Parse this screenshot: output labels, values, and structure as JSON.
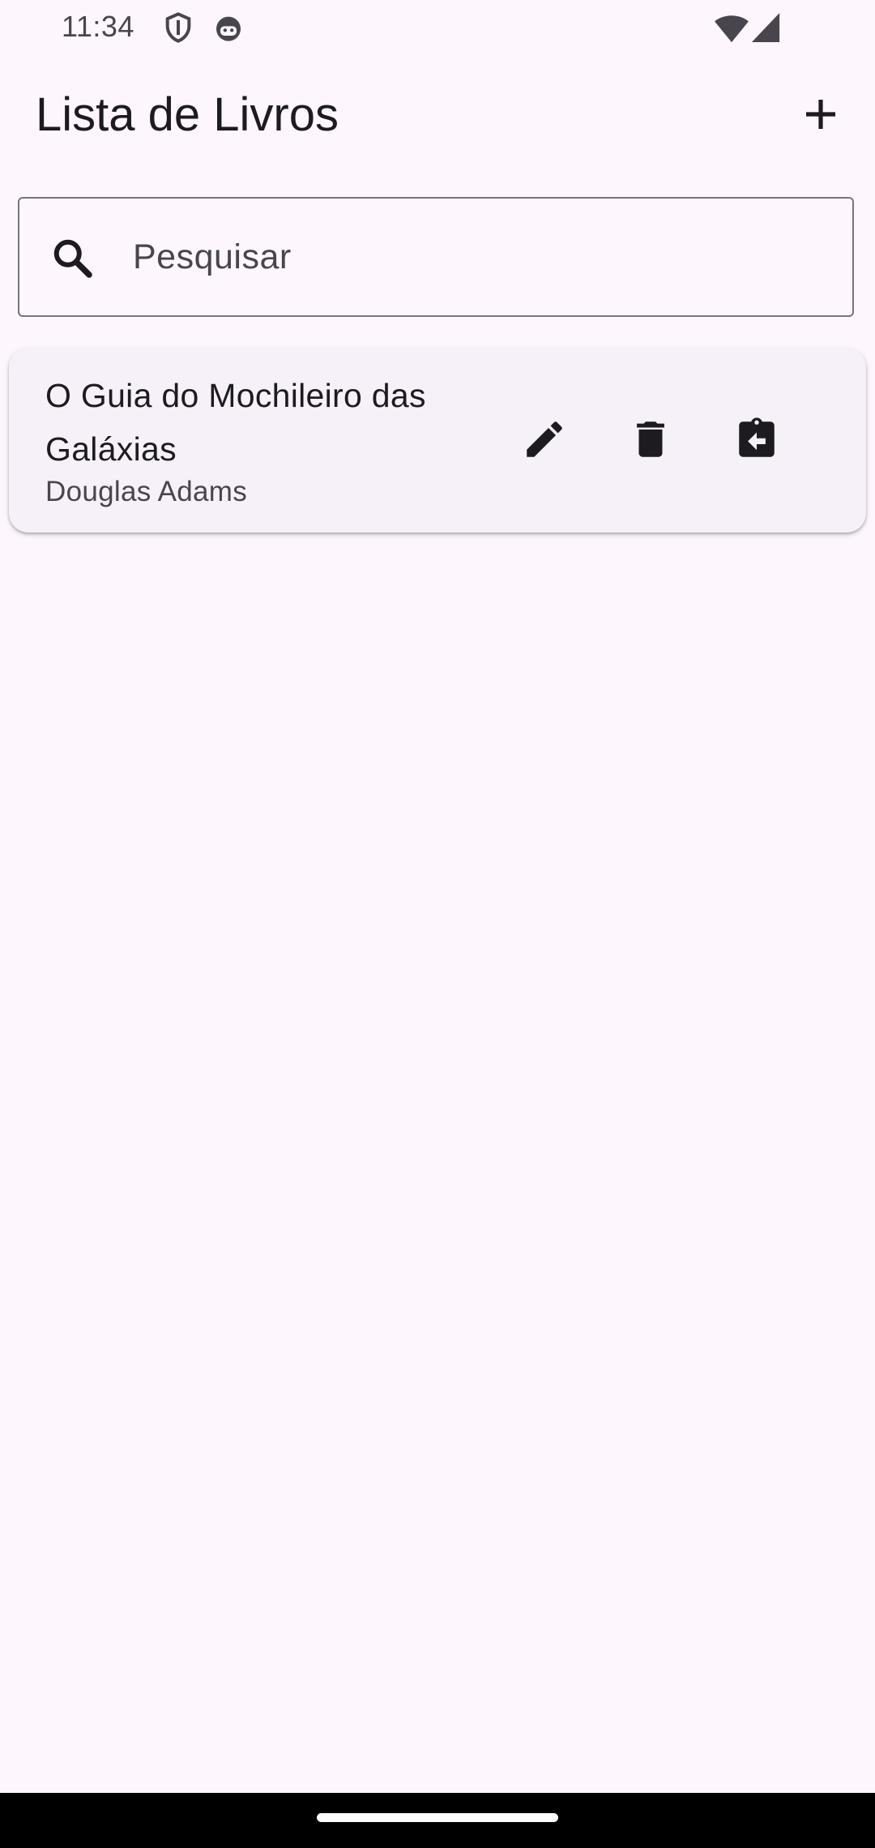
{
  "status_bar": {
    "time": "11:34",
    "icons": [
      "shield-icon",
      "android-debug-icon",
      "wifi-icon",
      "signal-icon"
    ]
  },
  "app_bar": {
    "title": "Lista de Livros",
    "add_icon": "plus-icon"
  },
  "search": {
    "placeholder": "Pesquisar",
    "value": "",
    "icon": "search-icon"
  },
  "books": [
    {
      "title": "O Guia do Mochileiro das Galáxias",
      "author": "Douglas Adams",
      "actions": [
        "edit-icon",
        "delete-icon",
        "return-book-icon"
      ]
    }
  ],
  "colors": {
    "background": "#fdf7fd",
    "card": "#f6f0f8",
    "text_primary": "#1d1b20",
    "text_secondary": "#49454f",
    "outline": "#79747e",
    "icon": "#1d1b20"
  }
}
